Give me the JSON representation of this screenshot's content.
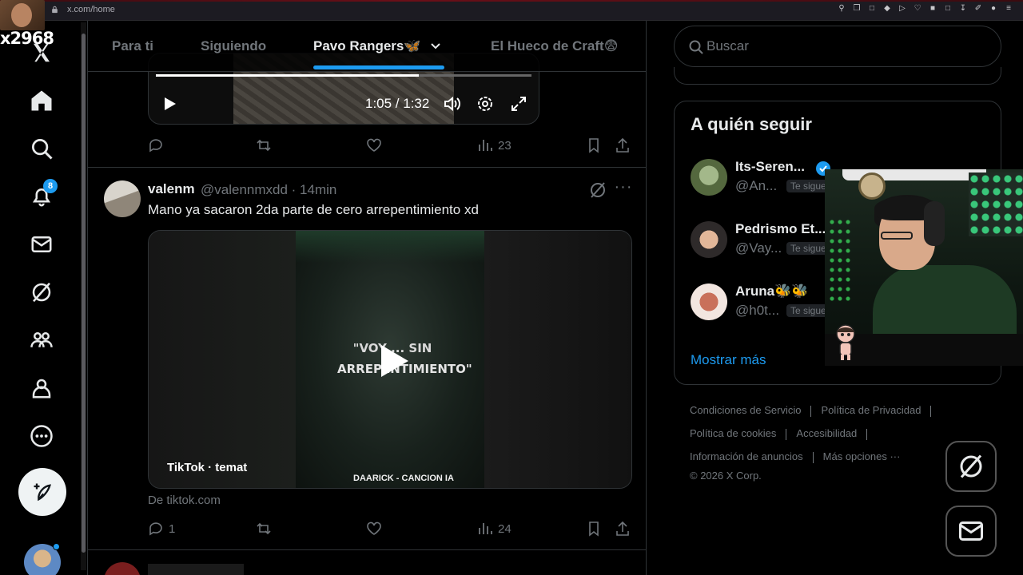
{
  "browser": {
    "url": "x.com/home"
  },
  "overlay": {
    "stream_tag": "x2968"
  },
  "nav": {
    "notifications_badge": "8"
  },
  "tabs": [
    {
      "label": "Para ti",
      "active": false
    },
    {
      "label": "Siguiendo",
      "active": false
    },
    {
      "label": "Pavo Rangers🦋",
      "active": true
    },
    {
      "label": "El Hueco de Craft😨",
      "active": false
    }
  ],
  "prev_tweet": {
    "video_time": "1:05 / 1:32",
    "video_progress": 0.7,
    "views": "23"
  },
  "tweet": {
    "name": "valenm",
    "handle": "@valennmxdd · 14min",
    "text": "Mano ya sacaron 2da parte de cero arrepentimiento xd",
    "video_caption_line1": "\"VOY ... SIN",
    "video_caption_line2": "ARREPENTIMIENTO\"",
    "video_source_label": "TikTok · temat",
    "video_watermark": "DAARICK - CANCION IA",
    "from_label": "De tiktok.com",
    "replies": "1",
    "views": "24"
  },
  "search": {
    "placeholder": "Buscar"
  },
  "who_to_follow": {
    "title": "A quién seguir",
    "items": [
      {
        "name": "Its-Seren...",
        "handle": "@An...",
        "follows_you": "Te sigue",
        "verified": true
      },
      {
        "name": "Pedrismo Et...",
        "handle": "@Vay...",
        "follows_you": "Te sigue",
        "verified": false
      },
      {
        "name": "Aruna🐝🐝",
        "handle": "@h0t...",
        "follows_you": "Te sigue",
        "verified": false
      }
    ],
    "show_more": "Mostrar más"
  },
  "footer": {
    "terms": "Condiciones de Servicio",
    "privacy": "Política de Privacidad",
    "cookies": "Política de cookies",
    "accessibility": "Accesibilidad",
    "ads_info": "Información de anuncios",
    "more": "Más opciones ···",
    "copyright": "© 2026 X Corp."
  },
  "colors": {
    "accent": "#1d9bf0",
    "background": "#000000",
    "border": "#2f3336",
    "muted": "#71767b"
  }
}
